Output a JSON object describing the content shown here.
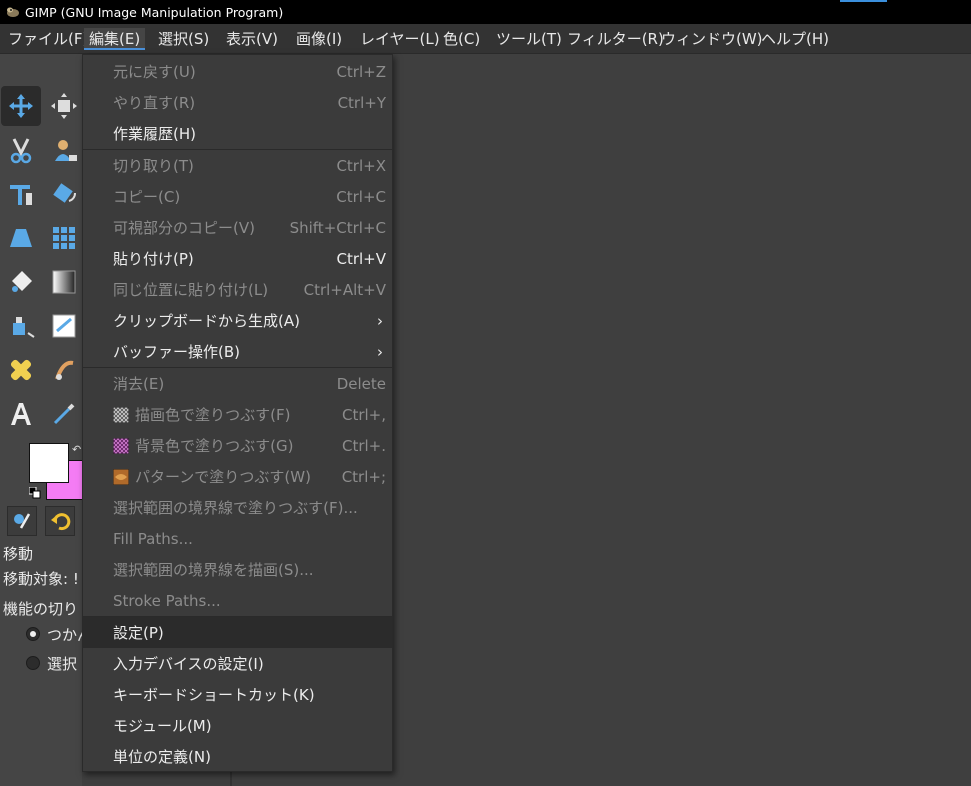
{
  "window": {
    "title": "GIMP (GNU Image Manipulation Program)"
  },
  "menubar": {
    "items": [
      {
        "label": "ファイル(F)"
      },
      {
        "label": "編集(E)"
      },
      {
        "label": "選択(S)"
      },
      {
        "label": "表示(V)"
      },
      {
        "label": "画像(I)"
      },
      {
        "label": "レイヤー(L)"
      },
      {
        "label": "色(C)"
      },
      {
        "label": "ツール(T)"
      },
      {
        "label": "フィルター(R)"
      },
      {
        "label": "ウィンドウ(W)"
      },
      {
        "label": "ヘルプ(H)"
      }
    ],
    "active_item": "編集(E)"
  },
  "edit_menu": {
    "items": [
      {
        "label": "元に戻す(U)",
        "accel": "Ctrl+Z",
        "enabled": false
      },
      {
        "label": "やり直す(R)",
        "accel": "Ctrl+Y",
        "enabled": false
      },
      {
        "label": "作業履歴(H)",
        "accel": "",
        "enabled": true
      },
      {
        "label": "切り取り(T)",
        "accel": "Ctrl+X",
        "enabled": false
      },
      {
        "label": "コピー(C)",
        "accel": "Ctrl+C",
        "enabled": false
      },
      {
        "label": "可視部分のコピー(V)",
        "accel": "Shift+Ctrl+C",
        "enabled": false
      },
      {
        "label": "貼り付け(P)",
        "accel": "Ctrl+V",
        "enabled": true
      },
      {
        "label": "同じ位置に貼り付け(L)",
        "accel": "Ctrl+Alt+V",
        "enabled": false
      },
      {
        "label": "クリップボードから生成(A)",
        "accel": "",
        "enabled": true,
        "submenu": true
      },
      {
        "label": "バッファー操作(B)",
        "accel": "",
        "enabled": true,
        "submenu": true
      },
      {
        "label": "消去(E)",
        "accel": "Delete",
        "enabled": false
      },
      {
        "label": "描画色で塗りつぶす(F)",
        "accel": "Ctrl+,",
        "enabled": false,
        "icon": "fg-fill-icon"
      },
      {
        "label": "背景色で塗りつぶす(G)",
        "accel": "Ctrl+.",
        "enabled": false,
        "icon": "bg-fill-icon"
      },
      {
        "label": "パターンで塗りつぶす(W)",
        "accel": "Ctrl+;",
        "enabled": false,
        "icon": "pattern-fill-icon"
      },
      {
        "label": "選択範囲の境界線で塗りつぶす(F)...",
        "accel": "",
        "enabled": false
      },
      {
        "label": "Fill Paths...",
        "accel": "",
        "enabled": false
      },
      {
        "label": "選択範囲の境界線を描画(S)...",
        "accel": "",
        "enabled": false
      },
      {
        "label": "Stroke Paths...",
        "accel": "",
        "enabled": false
      },
      {
        "label": "設定(P)",
        "accel": "",
        "enabled": true,
        "highlighted": true
      },
      {
        "label": "入力デバイスの設定(I)",
        "accel": "",
        "enabled": true
      },
      {
        "label": "キーボードショートカット(K)",
        "accel": "",
        "enabled": true
      },
      {
        "label": "モジュール(M)",
        "accel": "",
        "enabled": true
      },
      {
        "label": "単位の定義(N)",
        "accel": "",
        "enabled": true
      }
    ],
    "submenu_arrow": "›"
  },
  "toolbox": {
    "tools": [
      {
        "icon": "move-tool-icon",
        "selected": true
      },
      {
        "icon": "unified-transform-tool-icon"
      },
      {
        "icon": "free-select-scissors-icon"
      },
      {
        "icon": "foreground-select-tool-icon"
      },
      {
        "icon": "crop-tool-icon"
      },
      {
        "icon": "flip-tool-icon"
      },
      {
        "icon": "perspective-tool-icon"
      },
      {
        "icon": "cage-transform-tool-icon"
      },
      {
        "icon": "bucket-fill-tool-icon"
      },
      {
        "icon": "gradient-tool-icon"
      },
      {
        "icon": "ink-tool-icon"
      },
      {
        "icon": "mypaint-brush-tool-icon"
      },
      {
        "icon": "heal-tool-icon"
      },
      {
        "icon": "smudge-tool-icon"
      },
      {
        "icon": "text-tool-icon"
      },
      {
        "icon": "color-picker-tool-icon"
      }
    ],
    "fg_color": "#ffffff",
    "bg_color": "#f47cf4",
    "swap_glyph": "↶",
    "dock_tabs": [
      {
        "icon": "tool-options-tab-icon"
      },
      {
        "icon": "undo-history-tab-icon"
      }
    ]
  },
  "tool_options": {
    "title": "移動",
    "move_target_label": "移動対象:",
    "move_target_value": "!",
    "section_label": "機能の切り",
    "radios": [
      {
        "label": "つかん",
        "checked": true
      },
      {
        "label": "選択",
        "checked": false
      }
    ]
  },
  "colors": {
    "titlebar": "#000000",
    "menubar": "#333333",
    "menu_bg": "#3b3b3b",
    "menu_highlight": "#2b2b2b",
    "accent": "#4a90d9",
    "text_enabled": "#ececec",
    "text_disabled": "#8c8c8c"
  }
}
